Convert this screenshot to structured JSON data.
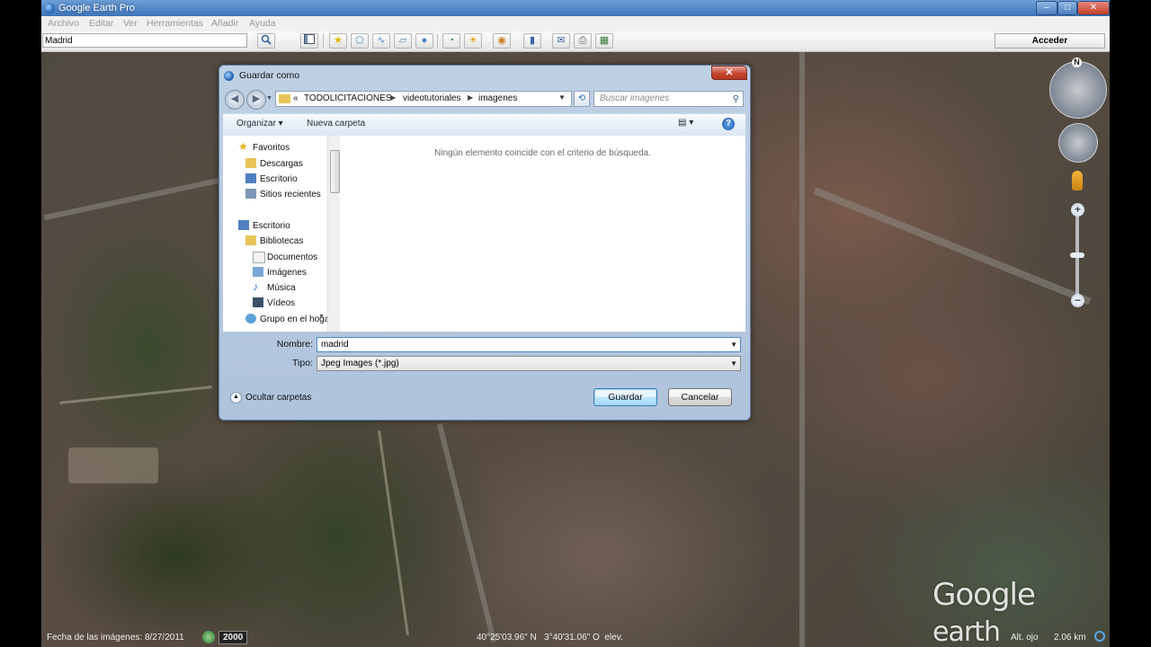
{
  "window": {
    "title": "Google Earth Pro",
    "controls": {
      "minimize": "–",
      "maximize": "□",
      "close": "✕"
    }
  },
  "menu": [
    "Archivo",
    "Editar",
    "Ver",
    "Herramientas",
    "Añadir",
    "Ayuda"
  ],
  "toolbar": {
    "search_value": "Madrid",
    "sign_in": "Acceder",
    "icons": [
      "search-icon",
      "sidebar-toggle-icon",
      "placemark-icon",
      "polygon-icon",
      "path-icon",
      "overlay-icon",
      "record-tour-icon",
      "historical-imagery-icon",
      "sun-icon",
      "planets-icon",
      "ruler-icon",
      "email-icon",
      "print-icon",
      "view-in-maps-icon"
    ]
  },
  "dialog": {
    "title": "Guardar como",
    "breadcrumb": [
      "TODOLICITACIONES",
      "videotutoriales",
      "imagenes"
    ],
    "breadcrumb_prefix": "«",
    "search_placeholder": "Buscar imagenes",
    "commands": {
      "organize": "Organizar",
      "new_folder": "Nueva carpeta"
    },
    "nav": {
      "favorites": {
        "label": "Favoritos",
        "items": [
          "Descargas",
          "Escritorio",
          "Sitios recientes"
        ]
      },
      "desktop": "Escritorio",
      "libraries": {
        "label": "Bibliotecas",
        "items": [
          "Documentos",
          "Imágenes",
          "Música",
          "Vídeos"
        ]
      },
      "homegroup": "Grupo en el hoga"
    },
    "empty_message": "Ningún elemento coincide con el criterio de búsqueda.",
    "filename_label": "Nombre:",
    "filename_value": "madrid",
    "filetype_label": "Tipo:",
    "filetype_value": "Jpeg Images (*.jpg)",
    "hide_folders": "Ocultar carpetas",
    "save_button": "Guardar",
    "cancel_button": "Cancelar"
  },
  "navigation": {
    "north": "N",
    "zoom_in": "+",
    "zoom_out": "−"
  },
  "status": {
    "imagery_date": "Fecha de las imágenes: 8/27/2011",
    "year": "2000",
    "coordinates": "40°25'03.96\" N   3°40'31.06\" O  elev.",
    "eye_alt_label": "Alt. ojo",
    "eye_alt": "2.06 km"
  },
  "logo": {
    "brand": "Google",
    "product": "earth"
  }
}
